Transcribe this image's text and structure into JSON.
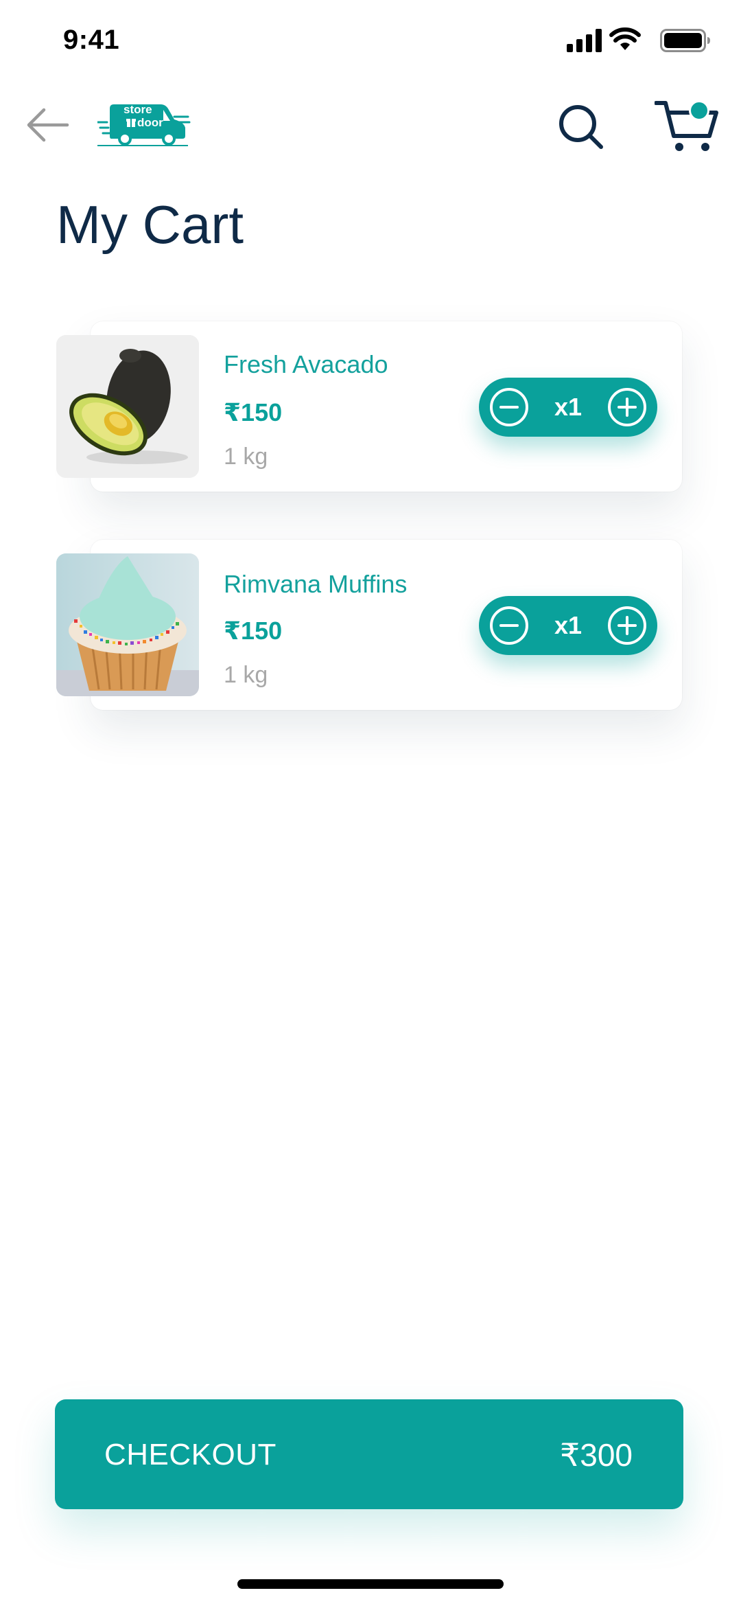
{
  "status_bar": {
    "time": "9:41",
    "icons": [
      "cellular-signal-icon",
      "wifi-icon",
      "battery-icon"
    ]
  },
  "header": {
    "logo": {
      "line1": "store",
      "line2": "door",
      "icon": "delivery-van-logo"
    },
    "icons": [
      "back-arrow-icon",
      "search-icon",
      "cart-icon"
    ],
    "cart_badge": true
  },
  "page": {
    "title": "My Cart"
  },
  "cart": {
    "items": [
      {
        "name": "Fresh Avacado",
        "price": "₹150",
        "unit": "1 kg",
        "quantity": "x1",
        "image": "avocado"
      },
      {
        "name": "Rimvana Muffins",
        "price": "₹150",
        "unit": "1 kg",
        "quantity": "x1",
        "image": "cupcake"
      }
    ]
  },
  "checkout": {
    "label": "CHECKOUT",
    "total": "₹300"
  },
  "colors": {
    "accent": "#0aa19b",
    "title": "#0f2a47",
    "muted": "#a8a8a8",
    "background": "#ffffff"
  }
}
